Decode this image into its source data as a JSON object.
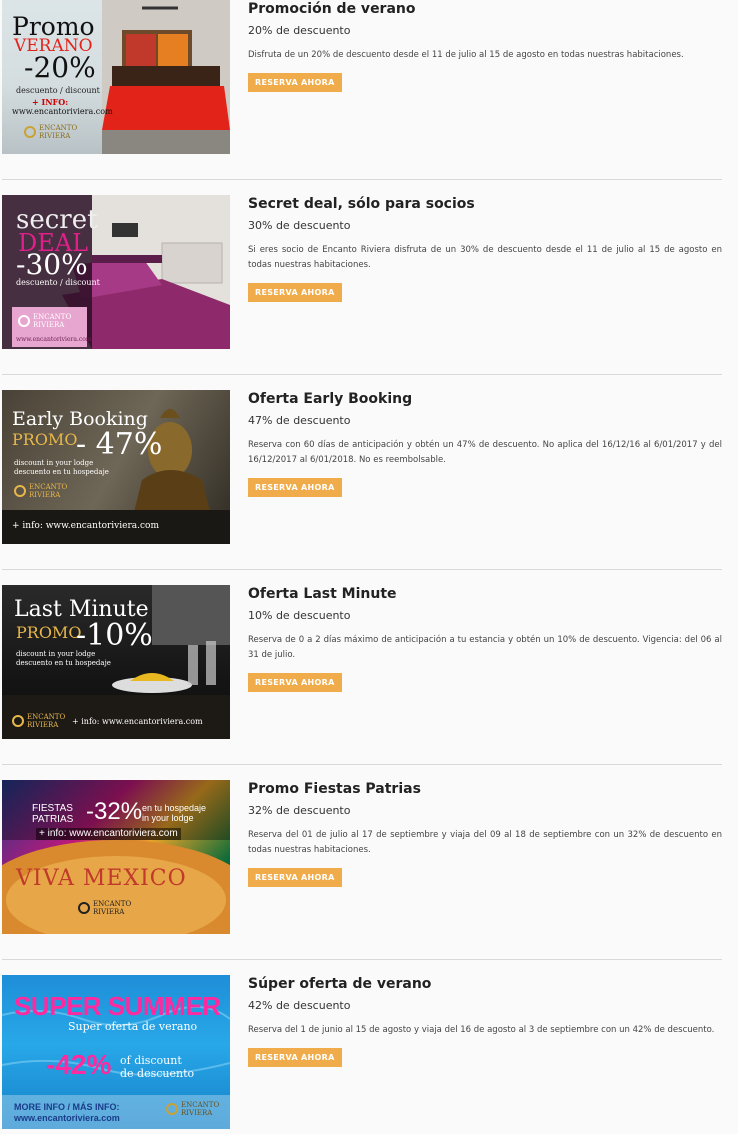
{
  "promos": [
    {
      "title": "Promoción de verano",
      "discount_text": "20% de descuento",
      "description": "Disfruta de un 20% de descuento desde el 11 de julio al 15 de agosto en todas nuestras habitaciones.",
      "button": "RESERVA AHORA",
      "image": {
        "l1": "Promo",
        "l2": "VERANO",
        "l3": "-20%",
        "l4": "descuento / discount",
        "l5": "+ INFO:",
        "l6": "www.encantoriviera.com",
        "logo": "ENCANTO RIVIERA"
      }
    },
    {
      "title": "Secret deal, sólo para socios",
      "discount_text": "30% de descuento",
      "description": "Si eres socio de Encanto Riviera disfruta de un 30% de descuento desde el 11 de julio al 15 de agosto en todas nuestras habitaciones.",
      "button": "RESERVA AHORA",
      "image": {
        "l1": "secret",
        "l2": "DEAL",
        "l3": "-30%",
        "l4": "descuento / discount",
        "logo": "ENCANTO RIVIERA",
        "l6": "www.encantoriviera.com"
      }
    },
    {
      "title": "Oferta Early Booking",
      "discount_text": "47% de descuento",
      "description": "Reserva con 60 días de anticipación y obtén un 47% de descuento. No aplica del 16/12/16 al 6/01/2017 y del 16/12/2017 al 6/01/2018. No es reembolsable.",
      "button": "RESERVA AHORA",
      "image": {
        "l1": "Early Booking",
        "l2": "PROMO",
        "l3": "- 47%",
        "l4": "discount in your lodge",
        "l5": "descuento en tu hospedaje",
        "logo": "ENCANTO RIVIERA",
        "l6": "+ info: www.encantoriviera.com"
      }
    },
    {
      "title": "Oferta Last Minute",
      "discount_text": "10% de descuento",
      "description": "Reserva de 0 a 2 días máximo de anticipación a tu estancia y obtén un 10% de descuento. Vigencia: del 06 al 31 de julio.",
      "button": "RESERVA AHORA",
      "image": {
        "l1": "Last Minute",
        "l2": "PROMO",
        "l3": "-10%",
        "l4": "discount in your lodge",
        "l5": "descuento en tu hospedaje",
        "logo": "ENCANTO RIVIERA",
        "l6": "+ info: www.encantoriviera.com"
      }
    },
    {
      "title": "Promo Fiestas Patrias",
      "discount_text": "32% de descuento",
      "description": "Reserva del 01 de julio al 17 de septiembre y viaja del 09 al 18 de septiembre con un 32% de descuento en todas nuestras habitaciones.",
      "button": "RESERVA AHORA",
      "image": {
        "l1": "FIESTAS",
        "l2": "PATRIAS",
        "l3": "-32%",
        "l4": "en tu hospedaje",
        "l5": "in your lodge",
        "l6": "+ info: www.encantoriviera.com",
        "l7": "VIVA MEXICO",
        "logo": "ENCANTO RIVIERA"
      }
    },
    {
      "title": "Súper oferta de verano",
      "discount_text": "42% de descuento",
      "description": "Reserva del 1 de junio al 15 de agosto y viaja del 16 de agosto al 3 de septiembre con un 42% de descuento.",
      "button": "RESERVA AHORA",
      "image": {
        "l1": "SUPER SUMMER",
        "l2": "Super oferta de verano",
        "l3": "-42%",
        "l4": "of discount",
        "l5": "de descuento",
        "l6": "MORE INFO / MÁS INFO:",
        "l7": "www.encantoriviera.com",
        "logo": "ENCANTO RIVIERA"
      }
    }
  ],
  "colors": {
    "button": "#f0ac4a",
    "separator": "#d9d9d9",
    "background": "#fafafa"
  }
}
